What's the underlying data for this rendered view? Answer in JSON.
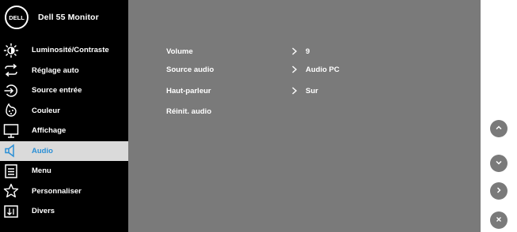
{
  "header": {
    "title": "Dell 55 Monitor",
    "logo_text": "DELL"
  },
  "colors": {
    "sidebar_bg": "#000000",
    "panel_bg": "#7a7a7a",
    "active_bg": "#dadada",
    "accent": "#2a8fd6"
  },
  "sidebar": {
    "items": [
      {
        "label": "Luminosité/Contraste",
        "icon": "brightness-icon"
      },
      {
        "label": "Réglage auto",
        "icon": "auto-adjust-icon"
      },
      {
        "label": "Source entrée",
        "icon": "input-source-icon"
      },
      {
        "label": "Couleur",
        "icon": "color-palette-icon"
      },
      {
        "label": "Affichage",
        "icon": "display-icon"
      },
      {
        "label": "Audio",
        "icon": "speaker-icon",
        "active": true
      },
      {
        "label": "Menu",
        "icon": "menu-icon"
      },
      {
        "label": "Personnaliser",
        "icon": "star-icon"
      },
      {
        "label": "Divers",
        "icon": "others-icon"
      }
    ]
  },
  "audio": {
    "rows": [
      {
        "label": "Volume",
        "value": "9"
      },
      {
        "label": "Source audio",
        "value": "Audio PC"
      },
      {
        "label": "Haut-parleur",
        "value": "Sur"
      },
      {
        "label": "Réinit. audio"
      }
    ]
  },
  "nav_buttons": [
    "up-icon",
    "down-icon",
    "right-icon",
    "close-icon"
  ]
}
